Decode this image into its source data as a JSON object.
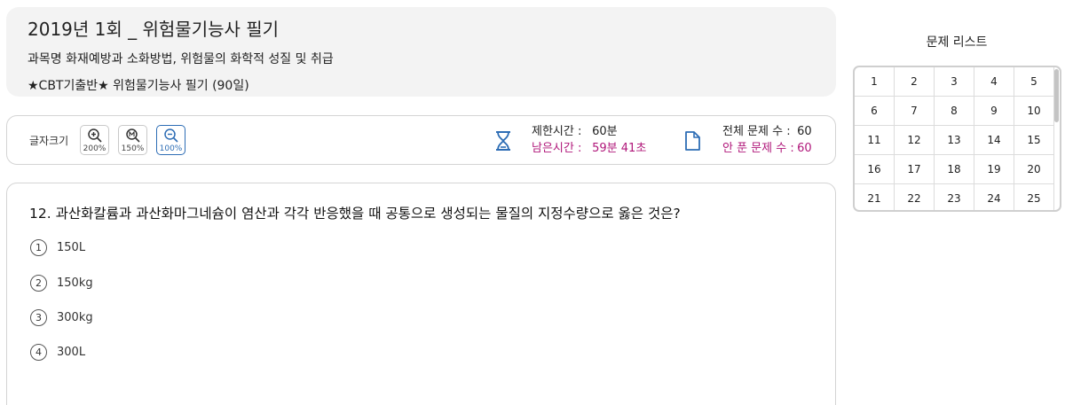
{
  "header": {
    "title": "2019년 1회 _ 위험물기능사 필기",
    "subject": "과목명 화재예방과 소화방법, 위험물의 화학적 성질 및 취급",
    "subtitle": "★CBT기출반★ 위험물기능사 필기 (90일)"
  },
  "toolbar": {
    "font_size_label": "글자크기",
    "zoom_options": [
      {
        "label": "200%",
        "icon": "zoom-in-icon"
      },
      {
        "label": "150%",
        "icon": "zoom-medium-icon"
      },
      {
        "label": "100%",
        "icon": "zoom-out-icon",
        "active": true
      }
    ],
    "time_limit_label": "제한시간 :",
    "time_limit_value": "60분",
    "time_remaining_label": "남은시간 :",
    "time_remaining_value": "59분 41초",
    "total_label": "전체 문제 수 :",
    "total_value": "60",
    "unsolved_label": "안 푼 문제 수 :",
    "unsolved_value": "60",
    "accent_color": "#2d6db5",
    "alert_color": "#b0177a"
  },
  "question": {
    "text": "12. 과산화칼륨과 과산화마그네슘이 염산과 각각 반응했을 때 공통으로 생성되는 물질의 지정수량으로 옳은 것은?",
    "choices": [
      {
        "num": "1",
        "text": "150L"
      },
      {
        "num": "2",
        "text": "150kg"
      },
      {
        "num": "3",
        "text": "300kg"
      },
      {
        "num": "4",
        "text": "300L"
      }
    ]
  },
  "question_list": {
    "title": "문제 리스트",
    "numbers": [
      "1",
      "2",
      "3",
      "4",
      "5",
      "6",
      "7",
      "8",
      "9",
      "10",
      "11",
      "12",
      "13",
      "14",
      "15",
      "16",
      "17",
      "18",
      "19",
      "20",
      "21",
      "22",
      "23",
      "24",
      "25"
    ]
  }
}
